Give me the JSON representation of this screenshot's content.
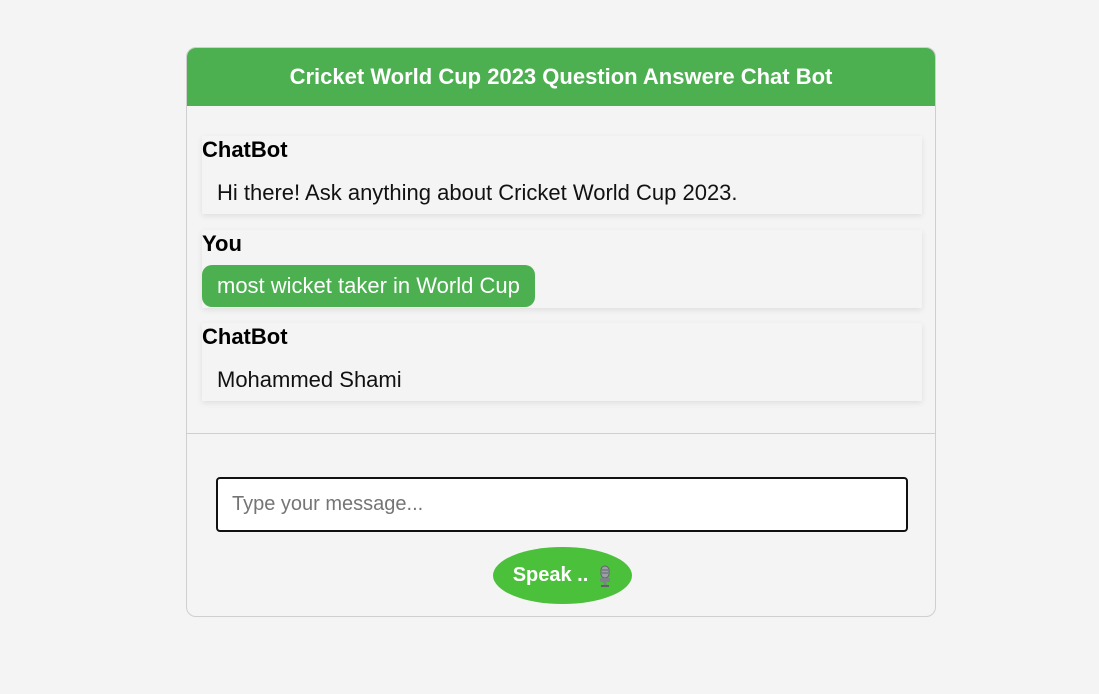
{
  "header": {
    "title": "Cricket World Cup 2023 Question Answere Chat Bot"
  },
  "messages": [
    {
      "sender": "ChatBot",
      "text": "Hi there! Ask anything about Cricket World Cup 2023."
    },
    {
      "sender": "You",
      "text": "most wicket taker in World Cup"
    },
    {
      "sender": "ChatBot",
      "text": "Mohammed Shami"
    }
  ],
  "input": {
    "placeholder": "Type your message...",
    "value": ""
  },
  "speak_button": {
    "label": "Speak ..",
    "icon": "microphone-icon"
  },
  "colors": {
    "accent": "#4caf50",
    "speak": "#4bc03a",
    "background": "#f4f4f4"
  }
}
